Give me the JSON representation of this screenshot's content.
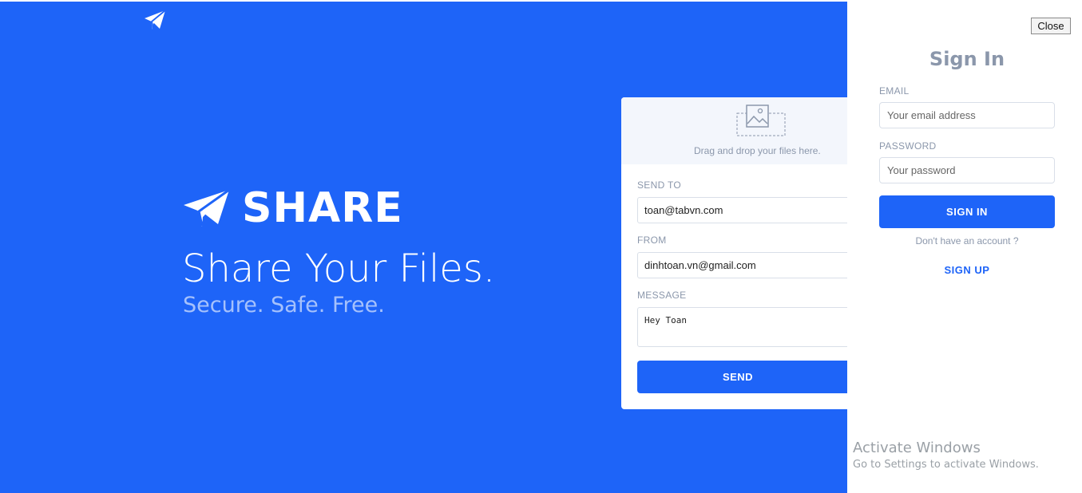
{
  "hero": {
    "brand_name": "SHARE",
    "headline": "Share Your Files.",
    "subline": "Secure. Safe. Free.",
    "background_color": "#1e64f8",
    "logo_icon": "paper-plane-icon"
  },
  "upload_card": {
    "dropzone_icon": "image-placeholder-icon",
    "dropzone_text": "Drag and drop your files here.",
    "send_to_label": "SEND TO",
    "send_to_value": "toan@tabvn.com",
    "from_label": "FROM",
    "from_value": "dinhtoan.vn@gmail.com",
    "message_label": "MESSAGE",
    "message_value": "Hey Toan",
    "send_button": "SEND"
  },
  "signin_panel": {
    "close_button": "Close",
    "title": "Sign In",
    "email_label": "EMAIL",
    "email_placeholder": "Your email address",
    "password_label": "PASSWORD",
    "password_placeholder": "Your password",
    "signin_button": "SIGN IN",
    "no_account_text": "Don't have an account ?",
    "signup_link": "SIGN UP"
  },
  "watermark": {
    "title": "Activate Windows",
    "subtitle": "Go to Settings to activate Windows."
  },
  "colors": {
    "accent": "#1e64f8",
    "muted_text": "#8b97ab"
  }
}
